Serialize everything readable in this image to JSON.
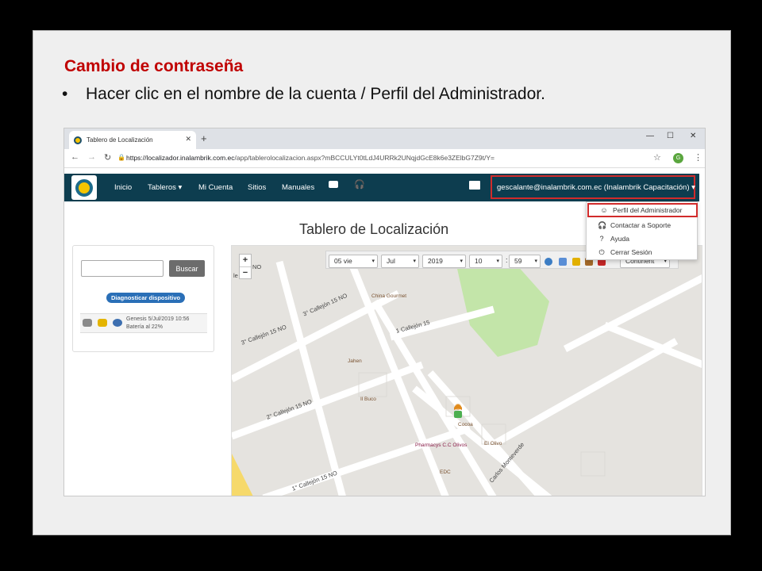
{
  "slide": {
    "title": "Cambio de contraseña",
    "bullet": "Hacer clic en el nombre de la cuenta / Perfil del Administrador."
  },
  "browser": {
    "tab_title": "Tablero de Localización",
    "url_host": "https://localizador.inalambrik.com.ec",
    "url_path": "/app/tablerolocalizacion.aspx?mBCCULYt0tLdJ4URRk2UNqjdGcE8k6e3ZElbG7Z9t/Y=",
    "avatar_letter": "G"
  },
  "navbar": {
    "items": [
      "Inicio",
      "Tableros ▾",
      "Mi Cuenta",
      "Sitios",
      "Manuales"
    ],
    "account": "gescalante@inalambrik.com.ec (Inalambrik Capacitación) ▾"
  },
  "dropdown": {
    "items": [
      {
        "label": "Perfil del Administrador",
        "icon": "user-icon"
      },
      {
        "label": "Contactar a Soporte",
        "icon": "headset-icon"
      },
      {
        "label": "Ayuda",
        "icon": "help-icon"
      },
      {
        "label": "Cerrar Sesión",
        "icon": "power-icon"
      }
    ]
  },
  "page": {
    "title": "Tablero de Localización"
  },
  "search": {
    "button": "Buscar",
    "diagnose": "Diagnosticar dispositivo"
  },
  "device": {
    "line1": "Genesis 5/Jul/2019 10:56",
    "line2": "Batería al 22%"
  },
  "map": {
    "date": {
      "day": "05 vie",
      "month": "Jul",
      "year": "2019",
      "hour": "10",
      "minute": "59",
      "colon": ":"
    },
    "layer": "Continent",
    "zoom_in": "+",
    "zoom_out": "−",
    "streets": [
      "3° Callejón 15 NO",
      "3° Callejón 15 NO",
      "1 Callejón 15",
      "2° Callejón 15 NO",
      "1° Callejón 15 NO",
      "Carlos Monteverde",
      "NO"
    ],
    "pois": [
      "China Gourmet",
      "Jahen",
      "Il Buco",
      "Cocoa",
      "El Olivo",
      "Pharmacys C.C Olivos",
      "EDC"
    ],
    "cut_label": "le"
  },
  "colors": {
    "accent": "#0d3d4f",
    "highlight": "#d12b2b",
    "title": "#c00000"
  }
}
